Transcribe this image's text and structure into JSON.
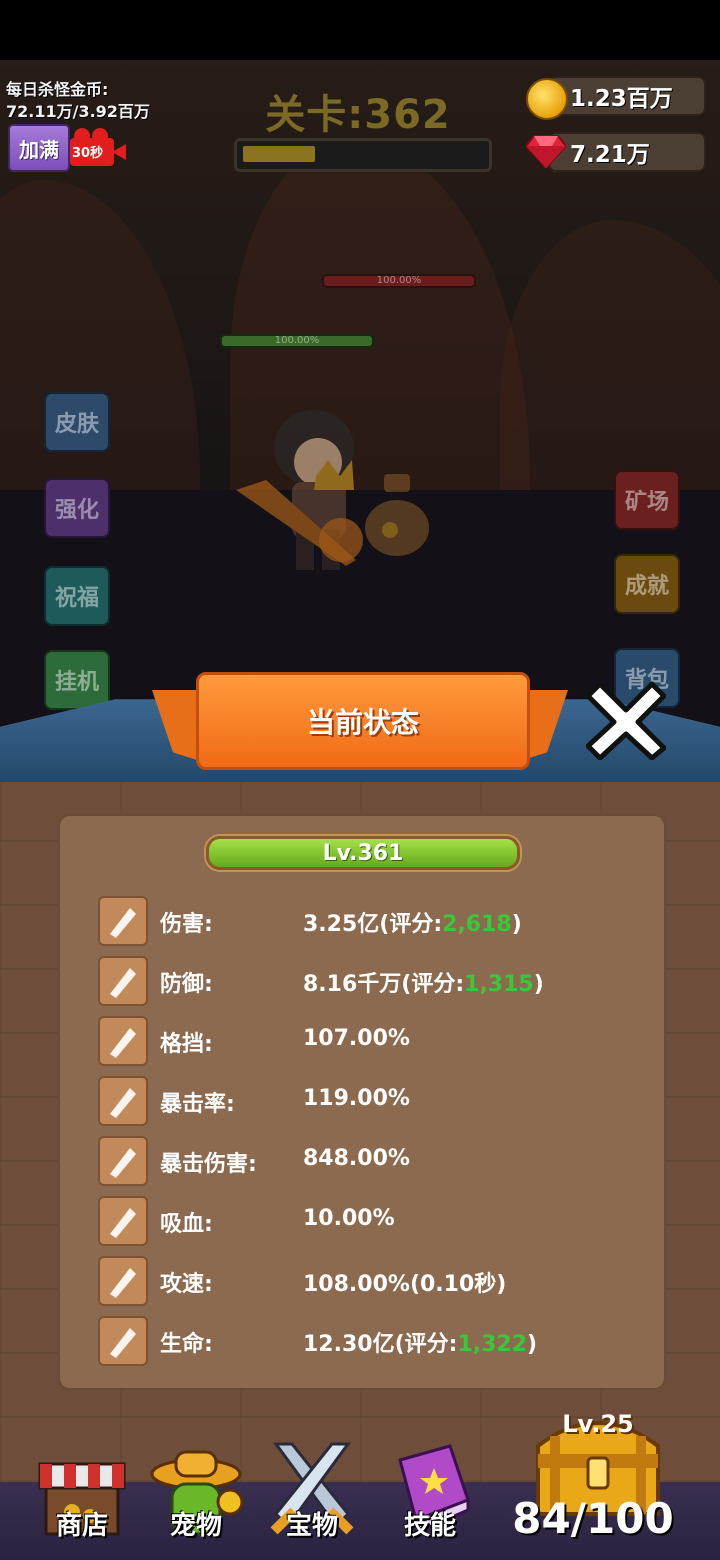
{
  "hud": {
    "daily_kill_label": "每日杀怪金币:",
    "daily_kill_value": "72.11万/3.92百万",
    "max_button": "加满",
    "video_timer": "30秒",
    "stage_title": "关卡:362",
    "stage_progress": 0.3,
    "gold": "1.23百万",
    "gems": "7.21万",
    "boss_hp": "100.00%",
    "hero_hp": "100.00%"
  },
  "side_buttons_left": [
    {
      "label": "皮肤",
      "color": "#2d4a6b"
    },
    {
      "label": "强化",
      "color": "#4d2f6b"
    },
    {
      "label": "祝福",
      "color": "#1f5a5a"
    },
    {
      "label": "挂机",
      "color": "#2d6b3a"
    }
  ],
  "side_buttons_right": [
    {
      "label": "矿场",
      "color": "#6b2020"
    },
    {
      "label": "成就",
      "color": "#6b4a10"
    },
    {
      "label": "背包",
      "color": "#2a4a6b"
    }
  ],
  "panel": {
    "title": "当前状态",
    "level": "Lv.361",
    "stats": [
      {
        "icon": "sword-icon",
        "label": "伤害:",
        "value": "3.25亿(评分:",
        "score": "2,618",
        "suffix": ")"
      },
      {
        "icon": "shield-icon",
        "label": "防御:",
        "value": "8.16千万(评分:",
        "score": "1,315",
        "suffix": ")"
      },
      {
        "icon": "block-shield-icon",
        "label": "格挡:",
        "value": "107.00%",
        "score": "",
        "suffix": ""
      },
      {
        "icon": "crit-icon",
        "label": "暴击率:",
        "value": "119.00%",
        "score": "",
        "suffix": ""
      },
      {
        "icon": "crit-damage-icon",
        "label": "暴击伤害:",
        "value": "848.00%",
        "score": "",
        "suffix": ""
      },
      {
        "icon": "lifesteal-icon",
        "label": "吸血:",
        "value": "10.00%",
        "score": "",
        "suffix": ""
      },
      {
        "icon": "attack-speed-icon",
        "label": "攻速:",
        "value": "108.00%(0.10秒)",
        "score": "",
        "suffix": ""
      },
      {
        "icon": "heart-icon",
        "label": "生命:",
        "value": "12.30亿(评分:",
        "score": "1,322",
        "suffix": ")"
      }
    ]
  },
  "bottom_nav": [
    {
      "label": "商店",
      "icon": "shop-icon"
    },
    {
      "label": "宠物",
      "icon": "pet-icon"
    },
    {
      "label": "宝物",
      "icon": "treasure-swords-icon"
    },
    {
      "label": "技能",
      "icon": "skill-book-icon"
    }
  ],
  "chest": {
    "level": "Lv.25",
    "count": "84/100"
  },
  "colors": {
    "score_green": "#3ac83a",
    "banner_orange": "#f16a18",
    "panel_brown": "#8b6a4f"
  }
}
